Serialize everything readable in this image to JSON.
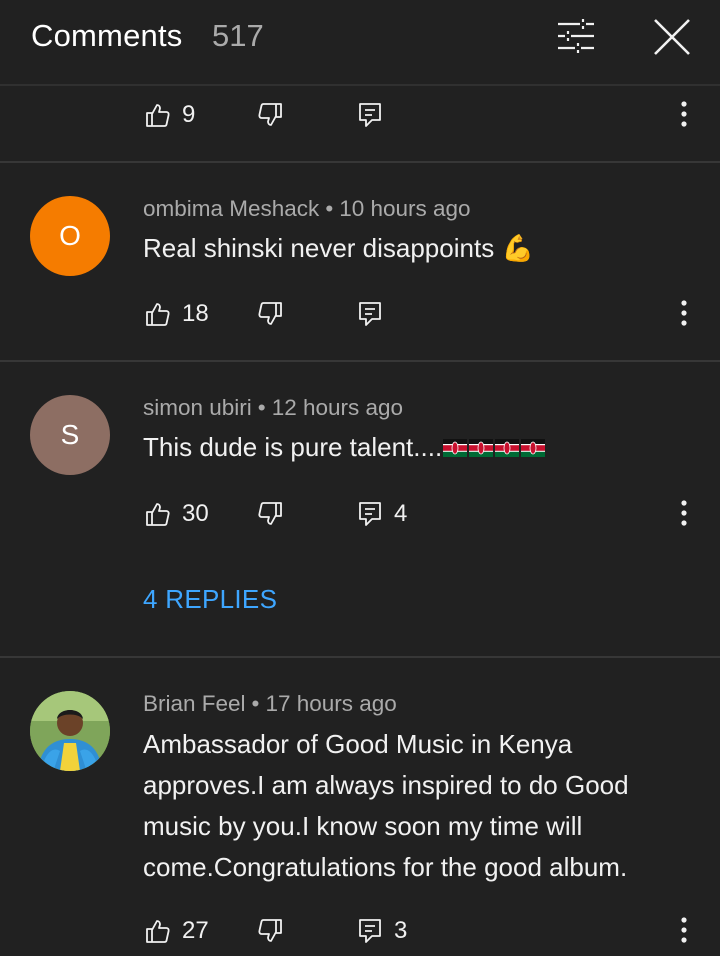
{
  "header": {
    "title": "Comments",
    "count": "517"
  },
  "icons": {
    "filter": "sliders-icon",
    "close": "close-icon",
    "like": "thumbs-up-icon",
    "dislike": "thumbs-down-icon",
    "reply": "comment-reply-icon",
    "more": "more-vertical-icon"
  },
  "colors": {
    "background": "#212121",
    "text_primary": "#f1f1f1",
    "text_secondary": "#aaaaaa",
    "link": "#3ea6ff",
    "divider": "#373737"
  },
  "partial_comment": {
    "likes": "9",
    "replies": ""
  },
  "comments": [
    {
      "author": "ombima Meshack",
      "time": "10 hours ago",
      "text": "Real shinski never disappoints",
      "emoji": "💪",
      "avatar_letter": "O",
      "avatar_color": "#f57c00",
      "likes": "18",
      "replies": ""
    },
    {
      "author": "simon ubiri",
      "time": "12 hours ago",
      "text": "This dude is pure talent....",
      "emoji": "🇰🇪🇰🇪🇰🇪🇰🇪",
      "avatar_letter": "S",
      "avatar_color": "#8d6e63",
      "likes": "30",
      "replies": "4",
      "replies_link": "4 REPLIES"
    },
    {
      "author": "Brian Feel",
      "time": "17 hours ago",
      "text": "Ambassador of Good Music in Kenya approves.I am always inspired to do Good music by you.I know soon my time will come.Congratulations for the good album.",
      "likes": "27",
      "replies": "3"
    }
  ]
}
